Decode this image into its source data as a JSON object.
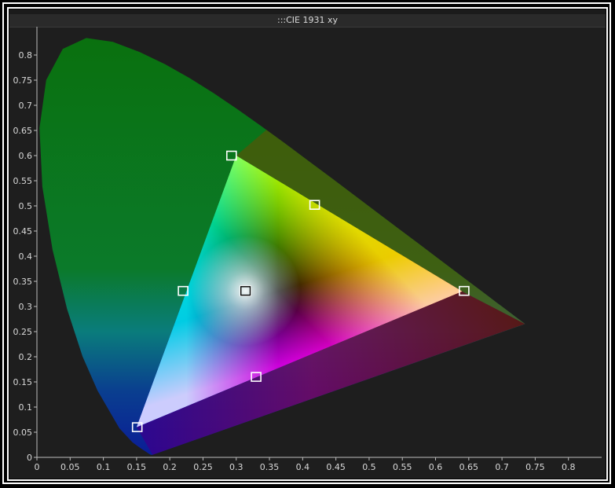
{
  "window": {
    "title": ":::CIE 1931 xy"
  },
  "chart_data": {
    "type": "scatter",
    "title": ":::CIE 1931 xy",
    "xlabel": "",
    "ylabel": "",
    "xlim": [
      0,
      0.85
    ],
    "ylim": [
      0,
      0.85
    ],
    "x_ticks": [
      "0",
      "0.05",
      "0.1",
      "0.15",
      "0.2",
      "0.25",
      "0.3",
      "0.35",
      "0.4",
      "0.45",
      "0.5",
      "0.55",
      "0.6",
      "0.65",
      "0.7",
      "0.75",
      "0.8"
    ],
    "y_ticks": [
      "0",
      "0.05",
      "0.1",
      "0.15",
      "0.2",
      "0.25",
      "0.3",
      "0.35",
      "0.4",
      "0.45",
      "0.5",
      "0.55",
      "0.6",
      "0.65",
      "0.7",
      "0.75",
      "0.8"
    ],
    "grid": false,
    "gamut_triangle": {
      "red": [
        0.64,
        0.33
      ],
      "green": [
        0.3,
        0.6
      ],
      "blue": [
        0.15,
        0.06
      ]
    },
    "spectral_locus": [
      [
        0.1741,
        0.005
      ],
      [
        0.174,
        0.005
      ],
      [
        0.1738,
        0.0049
      ],
      [
        0.1733,
        0.0048
      ],
      [
        0.1726,
        0.0048
      ],
      [
        0.1714,
        0.0051
      ],
      [
        0.1689,
        0.0069
      ],
      [
        0.1644,
        0.0109
      ],
      [
        0.1566,
        0.0177
      ],
      [
        0.144,
        0.0297
      ],
      [
        0.1241,
        0.0578
      ],
      [
        0.0913,
        0.1327
      ],
      [
        0.0687,
        0.2007
      ],
      [
        0.0454,
        0.295
      ],
      [
        0.0235,
        0.4127
      ],
      [
        0.0082,
        0.5384
      ],
      [
        0.0039,
        0.6548
      ],
      [
        0.0139,
        0.7502
      ],
      [
        0.0389,
        0.812
      ],
      [
        0.0743,
        0.8338
      ],
      [
        0.1142,
        0.8262
      ],
      [
        0.1547,
        0.8059
      ],
      [
        0.1929,
        0.7816
      ],
      [
        0.2296,
        0.7543
      ],
      [
        0.2658,
        0.7243
      ],
      [
        0.3016,
        0.6923
      ],
      [
        0.3373,
        0.6589
      ],
      [
        0.3731,
        0.6245
      ],
      [
        0.4087,
        0.5896
      ],
      [
        0.4441,
        0.5547
      ],
      [
        0.4788,
        0.5202
      ],
      [
        0.5125,
        0.4866
      ],
      [
        0.5448,
        0.4544
      ],
      [
        0.5752,
        0.4242
      ],
      [
        0.6029,
        0.3965
      ],
      [
        0.627,
        0.3725
      ],
      [
        0.6482,
        0.3514
      ],
      [
        0.6658,
        0.334
      ],
      [
        0.6801,
        0.3197
      ],
      [
        0.6915,
        0.3083
      ],
      [
        0.7006,
        0.2993
      ],
      [
        0.7079,
        0.292
      ],
      [
        0.714,
        0.2859
      ],
      [
        0.719,
        0.2809
      ],
      [
        0.723,
        0.277
      ],
      [
        0.726,
        0.274
      ],
      [
        0.7283,
        0.2717
      ],
      [
        0.73,
        0.27
      ],
      [
        0.7311,
        0.2689
      ],
      [
        0.732,
        0.268
      ],
      [
        0.7327,
        0.2673
      ],
      [
        0.7334,
        0.2666
      ],
      [
        0.734,
        0.266
      ],
      [
        0.7344,
        0.2656
      ],
      [
        0.7346,
        0.2654
      ],
      [
        0.7347,
        0.2653
      ]
    ],
    "target_points": [
      {
        "name": "green",
        "x": 0.293,
        "y": 0.6
      },
      {
        "name": "yellow",
        "x": 0.418,
        "y": 0.502
      },
      {
        "name": "red",
        "x": 0.643,
        "y": 0.331
      },
      {
        "name": "cyan",
        "x": 0.22,
        "y": 0.331
      },
      {
        "name": "white",
        "x": 0.314,
        "y": 0.331
      },
      {
        "name": "magenta",
        "x": 0.33,
        "y": 0.16
      },
      {
        "name": "blue",
        "x": 0.151,
        "y": 0.06
      }
    ],
    "colors": {
      "background": "#1e1e1e",
      "marker": "#ffffff",
      "axis": "#bdbdbd",
      "tick_label": "#d9d9d9"
    }
  }
}
